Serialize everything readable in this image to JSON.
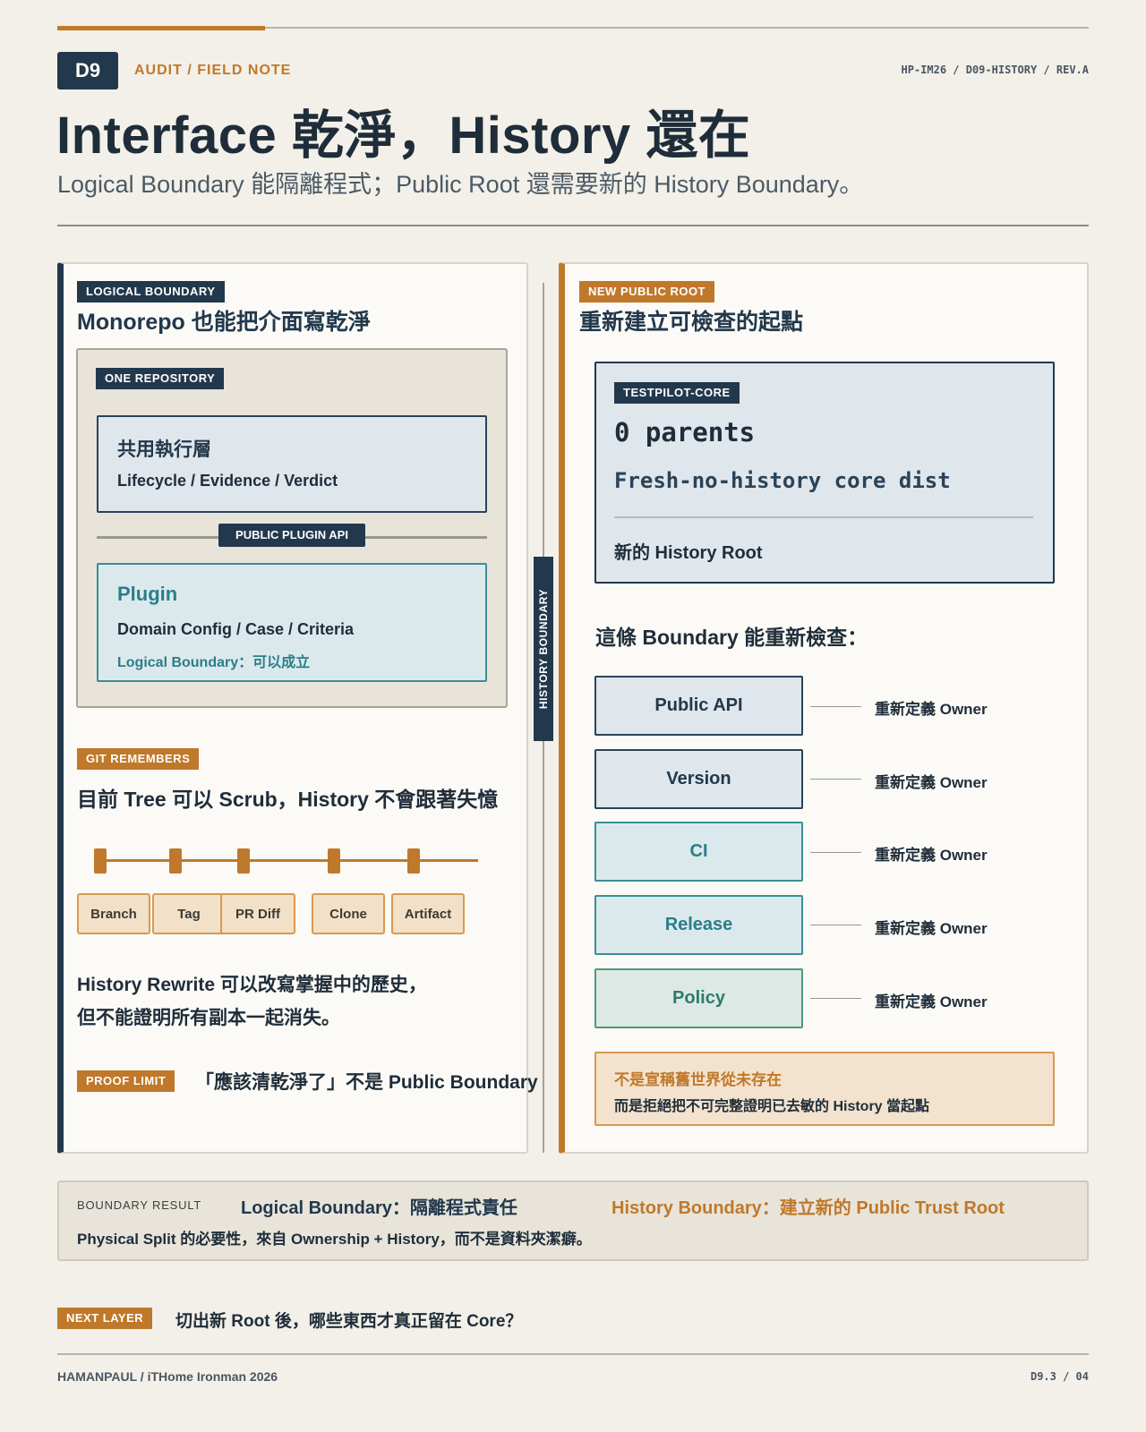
{
  "header": {
    "badge": "D9",
    "kicker": "AUDIT / FIELD NOTE",
    "doc_ref": "HP-IM26 / D09-HISTORY / REV.A",
    "title": "Interface 乾淨，History 還在",
    "subtitle": "Logical Boundary 能隔離程式；Public Root 還需要新的 History Boundary。"
  },
  "left_panel": {
    "tag": "LOGICAL BOUNDARY",
    "title": "Monorepo 也能把介面寫乾淨",
    "repo_tag": "ONE REPOSITORY",
    "exec_title": "共用執行層",
    "exec_sub": "Lifecycle / Evidence / Verdict",
    "api_tag": "PUBLIC PLUGIN API",
    "plugin_title": "Plugin",
    "plugin_sub": "Domain Config / Case / Criteria",
    "plugin_note": "Logical Boundary：可以成立",
    "git_tag": "GIT REMEMBERS",
    "git_title": "目前 Tree 可以 Scrub，History 不會跟著失憶",
    "chips": [
      "Branch",
      "Tag",
      "PR Diff",
      "Clone",
      "Artifact"
    ],
    "rewrite_line1": "History Rewrite 可以改寫掌握中的歷史，",
    "rewrite_line2": "但不能證明所有副本一起消失。",
    "proof_tag": "PROOF LIMIT",
    "proof_text": "「應該清乾淨了」不是 Public Boundary"
  },
  "divider": {
    "label": "HISTORY BOUNDARY"
  },
  "right_panel": {
    "tag": "NEW PUBLIC ROOT",
    "title": "重新建立可檢查的起點",
    "core_tag": "TESTPILOT-CORE",
    "core_parents": "0 parents",
    "core_dist": "Fresh-no-history core dist",
    "core_root": "新的 History Root",
    "recheck_title": "這條 Boundary 能重新檢查：",
    "owners": [
      {
        "name": "Public API",
        "label": "重新定義 Owner"
      },
      {
        "name": "Version",
        "label": "重新定義 Owner"
      },
      {
        "name": "CI",
        "label": "重新定義 Owner"
      },
      {
        "name": "Release",
        "label": "重新定義 Owner"
      },
      {
        "name": "Policy",
        "label": "重新定義 Owner"
      }
    ],
    "warn_line1": "不是宣稱舊世界從未存在",
    "warn_line2": "而是拒絕把不可完整證明已去敏的 History 當起點"
  },
  "result": {
    "label": "BOUNDARY RESULT",
    "logical": "Logical Boundary：隔離程式責任",
    "history": "History Boundary：建立新的 Public Trust Root",
    "note": "Physical Split 的必要性，來自 Ownership + History，而不是資料夾潔癖。"
  },
  "next": {
    "tag": "NEXT LAYER",
    "text": "切出新 Root 後，哪些東西才真正留在 Core？"
  },
  "footer": {
    "left": "HAMANPAUL / iTHome Ironman 2026",
    "right": "D9.3 / 04"
  },
  "colors": {
    "navy": "#22384c",
    "orange": "#c0782a",
    "teal": "#2a7e8a",
    "background": "#f2f0e8"
  }
}
